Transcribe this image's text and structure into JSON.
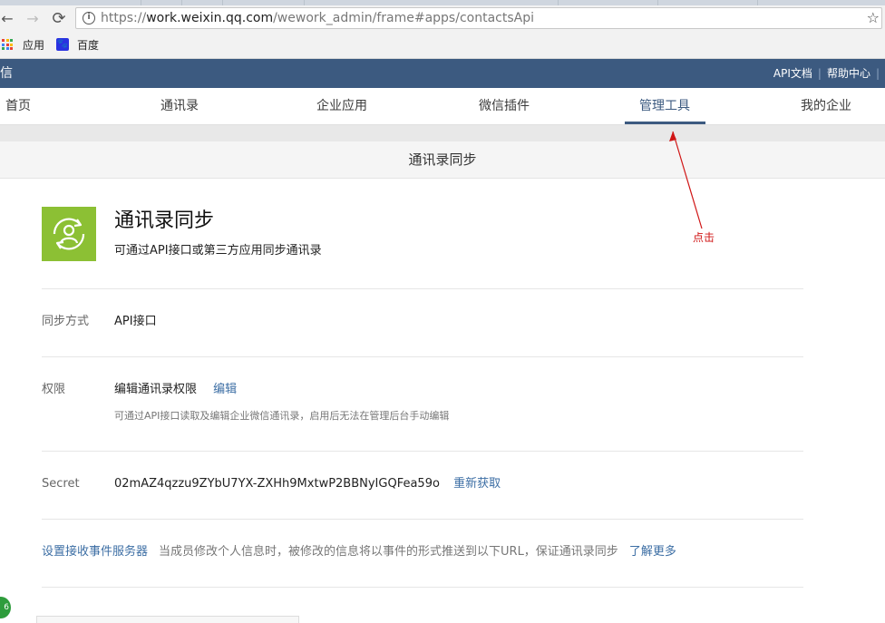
{
  "browser": {
    "url_prefix": "https://",
    "url_host": "work.weixin.qq.com",
    "url_path": "/wework_admin/frame#apps/contactsApi",
    "back_glyph": "←",
    "forward_glyph": "→",
    "reload_glyph": "⟳",
    "star_glyph": "☆",
    "bookmarks": [
      {
        "label": "应用",
        "icon": "apps-grid-icon"
      },
      {
        "label": "百度",
        "icon": "baidu-icon"
      }
    ]
  },
  "topbar": {
    "brand": "信",
    "links": [
      "API文档",
      "帮助中心"
    ],
    "separator": "|",
    "bg_color": "#3c5a80"
  },
  "nav": {
    "items": [
      "首页",
      "通讯录",
      "企业应用",
      "微信插件",
      "管理工具",
      "我的企业"
    ],
    "active_index": 4
  },
  "page": {
    "subheader": "通讯录同步",
    "app_title": "通讯录同步",
    "app_desc": "可通过API接口或第三方应用同步通讯录",
    "app_icon": "user-sync-icon",
    "app_icon_color": "#8cc034"
  },
  "rows": {
    "sync": {
      "label": "同步方式",
      "value": "API接口"
    },
    "permission": {
      "label": "权限",
      "value": "编辑通讯录权限",
      "action": "编辑",
      "note": "可通过API接口读取及编辑企业微信通讯录，启用后无法在管理后台手动编辑"
    },
    "secret": {
      "label": "Secret",
      "value": "02mAZ4qzzu9ZYbU7YX-ZXHh9MxtwP2BBNyIGQFea59o",
      "action": "重新获取"
    },
    "event": {
      "link": "设置接收事件服务器",
      "desc": "当成员修改个人信息时，被修改的信息将以事件的形式推送到以下URL，保证通讯录同步",
      "more": "了解更多"
    }
  },
  "annotation": {
    "text": "点击",
    "color": "#d01616"
  },
  "corner_badge": "6"
}
